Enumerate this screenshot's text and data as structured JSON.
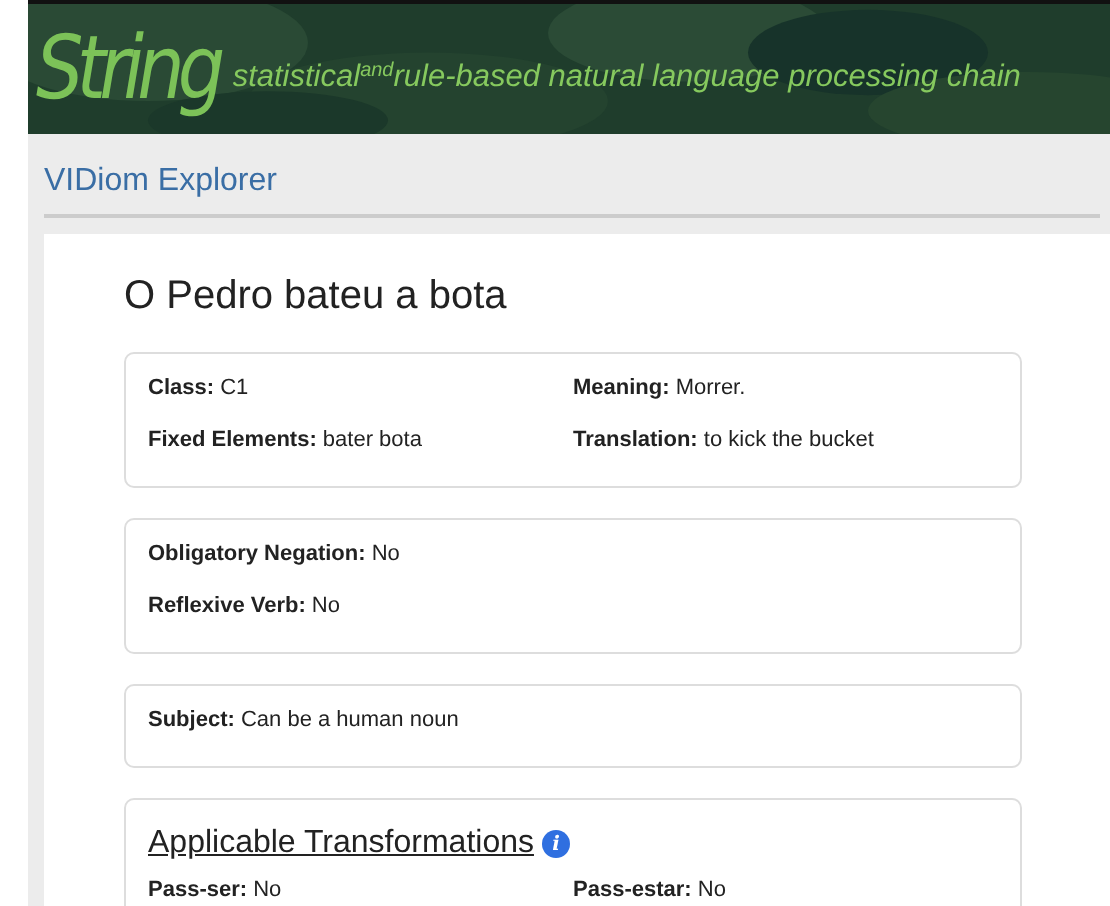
{
  "header": {
    "logo": "String",
    "tagline": "statistical$^{and}$rule-based natural language processing chain"
  },
  "app_title": "VIDiom Explorer",
  "idiom_title": "O Pedro bateu a bota",
  "sections": [
    {
      "kind": "two_column",
      "fields": [
        "**Class:** C1",
        "**Meaning:** Morrer.",
        "**Fixed Elements:** bater bota",
        "**Translation:** to kick the bucket"
      ]
    },
    {
      "kind": "one_column",
      "fields": [
        "**Obligatory Negation:** No",
        "**Reflexive Verb:** No"
      ]
    },
    {
      "kind": "one_column",
      "fields": [
        "**Subject:** Can be a human noun"
      ]
    },
    {
      "kind": "two_column",
      "heading": "Applicable Transformations",
      "info": "i",
      "fields": [
        "**Pass-ser:** No",
        "**Pass-estar:** No"
      ]
    }
  ]
}
